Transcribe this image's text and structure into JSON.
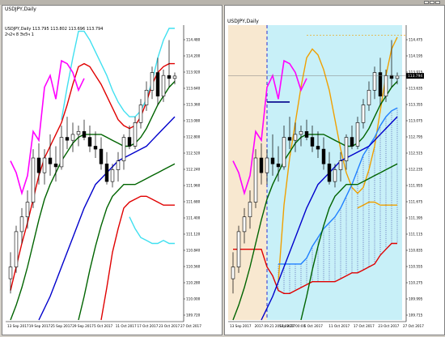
{
  "left_chart": {
    "title": "USDJPY,Daily",
    "info_line1": "USDJPY,Daily  113.795 113.802 113.696 113.794",
    "info_line2": "2ч2ч 8 Эх5ч 1"
  },
  "right_chart": {
    "title": "USDJPY,Daily",
    "info_line1": "USDJPY,Daily  113.795 113.802 113.696 113.794",
    "price_label": "113.794"
  },
  "colors": {
    "bull": "#ffffff",
    "bear": "#000000",
    "cyan_band": "#40e0f0",
    "red_band": "#e00000",
    "green_band": "#006400",
    "blue_ma": "#0000cc",
    "magenta": "#ff00ff",
    "orange": "#f0a000",
    "cloud": "#c8f0f8",
    "tan": "#f8e8d0"
  },
  "chart_data": [
    {
      "type": "candlestick",
      "title": "USDJPY,Daily",
      "x_tick_labels": [
        "13 Sep 2017",
        "19 Sep 2017",
        "25 Sep 2017",
        "29 Sep 2017",
        "5 Oct 2017",
        "11 Oct 2017",
        "17 Oct 2017",
        "23 Oct 2017",
        "27 Oct 2017"
      ],
      "y_tick_labels": [
        "114.480",
        "114.200",
        "113.920",
        "113.640",
        "113.360",
        "113.080",
        "112.800",
        "112.520",
        "112.240",
        "111.960",
        "111.680",
        "111.400",
        "111.120",
        "110.840",
        "110.560",
        "110.280",
        "110.000",
        "109.720"
      ],
      "ylim": [
        109.65,
        114.6
      ],
      "candles": [
        [
          110.35,
          110.8,
          110.1,
          110.55
        ],
        [
          110.55,
          111.25,
          110.45,
          111.15
        ],
        [
          111.15,
          111.55,
          110.95,
          111.4
        ],
        [
          111.4,
          111.85,
          111.2,
          111.65
        ],
        [
          111.65,
          112.55,
          111.55,
          112.4
        ],
        [
          112.4,
          112.65,
          111.95,
          112.15
        ],
        [
          112.15,
          112.55,
          111.95,
          112.4
        ],
        [
          112.4,
          112.8,
          112.1,
          112.3
        ],
        [
          112.3,
          112.6,
          112.0,
          112.25
        ],
        [
          112.25,
          112.95,
          112.2,
          112.75
        ],
        [
          112.75,
          113.1,
          112.55,
          112.7
        ],
        [
          112.7,
          113.0,
          112.5,
          112.8
        ],
        [
          112.8,
          112.95,
          112.6,
          112.85
        ],
        [
          112.85,
          113.05,
          112.7,
          112.75
        ],
        [
          112.75,
          112.95,
          112.5,
          112.6
        ],
        [
          112.6,
          112.85,
          112.4,
          112.55
        ],
        [
          112.55,
          112.75,
          112.2,
          112.3
        ],
        [
          112.3,
          112.5,
          111.95,
          112.0
        ],
        [
          112.0,
          112.3,
          111.9,
          112.2
        ],
        [
          112.2,
          112.5,
          112.0,
          112.35
        ],
        [
          112.35,
          112.8,
          112.2,
          112.75
        ],
        [
          112.75,
          112.95,
          112.55,
          112.6
        ],
        [
          112.6,
          113.1,
          112.55,
          113.0
        ],
        [
          113.0,
          113.4,
          112.9,
          113.3
        ],
        [
          113.3,
          113.7,
          113.2,
          113.55
        ],
        [
          113.55,
          113.95,
          113.4,
          113.85
        ],
        [
          113.85,
          114.1,
          113.3,
          113.45
        ],
        [
          113.45,
          113.9,
          113.35,
          113.8
        ],
        [
          113.8,
          114.4,
          113.6,
          113.75
        ],
        [
          113.75,
          113.85,
          113.65,
          113.79
        ]
      ],
      "series": [
        {
          "name": "",
          "color": "#40e0f0",
          "values": [
            null,
            null,
            null,
            null,
            null,
            null,
            null,
            null,
            null,
            113.05,
            113.6,
            114.1,
            114.55,
            114.55,
            114.4,
            114.2,
            114.0,
            113.8,
            113.55,
            113.35,
            113.2,
            113.1,
            113.1,
            113.2,
            113.4,
            113.7,
            114.1,
            114.4,
            114.6,
            114.6
          ]
        },
        {
          "name": "",
          "color": "#e00000",
          "values": [
            110.15,
            110.55,
            110.95,
            111.3,
            111.7,
            112.1,
            112.4,
            112.6,
            112.8,
            113.0,
            113.3,
            113.65,
            113.95,
            114.0,
            113.95,
            113.8,
            113.65,
            113.45,
            113.25,
            113.05,
            112.95,
            112.9,
            112.95,
            113.1,
            113.35,
            113.65,
            113.85,
            113.95,
            114.0,
            114.0
          ]
        },
        {
          "name": "",
          "color": "#006400",
          "values": [
            109.65,
            109.9,
            110.2,
            110.55,
            110.95,
            111.35,
            111.7,
            111.95,
            112.15,
            112.35,
            112.5,
            112.65,
            112.75,
            112.8,
            112.8,
            112.8,
            112.8,
            112.75,
            112.7,
            112.65,
            112.6,
            112.6,
            112.65,
            112.75,
            112.9,
            113.1,
            113.3,
            113.45,
            113.6,
            113.7
          ]
        },
        {
          "name": "",
          "color": "#0000cc",
          "values": [
            null,
            null,
            null,
            null,
            null,
            109.65,
            109.85,
            110.05,
            110.3,
            110.55,
            110.8,
            111.05,
            111.3,
            111.55,
            111.75,
            111.95,
            112.05,
            112.15,
            112.25,
            112.35,
            112.4,
            112.45,
            112.5,
            112.55,
            112.6,
            112.7,
            112.8,
            112.9,
            113.0,
            113.1
          ]
        },
        {
          "name": "",
          "color": "#006400",
          "values": [
            null,
            null,
            null,
            null,
            null,
            null,
            null,
            null,
            null,
            null,
            null,
            null,
            109.65,
            110.05,
            110.5,
            110.9,
            111.25,
            111.55,
            111.75,
            111.85,
            111.95,
            111.95,
            111.95,
            112.0,
            112.05,
            112.1,
            112.15,
            112.2,
            112.25,
            112.3
          ]
        },
        {
          "name": "",
          "color": "#e00000",
          "values": [
            null,
            null,
            null,
            null,
            null,
            null,
            null,
            null,
            null,
            null,
            null,
            null,
            null,
            null,
            null,
            null,
            109.65,
            110.2,
            110.8,
            111.2,
            111.55,
            111.65,
            111.7,
            111.75,
            111.75,
            111.7,
            111.65,
            111.6,
            111.6,
            111.6
          ]
        },
        {
          "name": "",
          "color": "#40e0f0",
          "values": [
            null,
            null,
            null,
            null,
            null,
            null,
            null,
            null,
            null,
            null,
            null,
            null,
            null,
            null,
            null,
            null,
            null,
            null,
            null,
            null,
            null,
            111.4,
            111.2,
            111.05,
            111.0,
            110.95,
            110.95,
            111.0,
            110.95,
            110.95
          ]
        }
      ],
      "lagging_span": {
        "start_index": 0,
        "color": "#ff00ff",
        "values": [
          112.35,
          112.15,
          111.8,
          112.1,
          112.85,
          112.7,
          113.6,
          113.8,
          113.4,
          114.05,
          114.0,
          113.85,
          113.55,
          113.75
        ]
      }
    },
    {
      "type": "candlestick",
      "title": "USDJPY,Daily",
      "x_tick_labels": [
        "13 Sep 2017",
        "2017.09.21 2017.09.27 00:00",
        "Sep 2017",
        "5 Oct 2017",
        "11 Oct 2017",
        "17 Oct 2017",
        "23 Oct 2017",
        "27 Oct 2017"
      ],
      "y_tick_labels": [
        "114.475",
        "114.195",
        "113.915",
        "113.635",
        "113.355",
        "113.075",
        "112.795",
        "112.515",
        "112.235",
        "111.955",
        "111.675",
        "111.395",
        "111.115",
        "110.835",
        "110.555",
        "110.275",
        "109.995",
        "109.715"
      ],
      "ylim": [
        109.65,
        114.6
      ],
      "current_price": 113.794
    }
  ]
}
